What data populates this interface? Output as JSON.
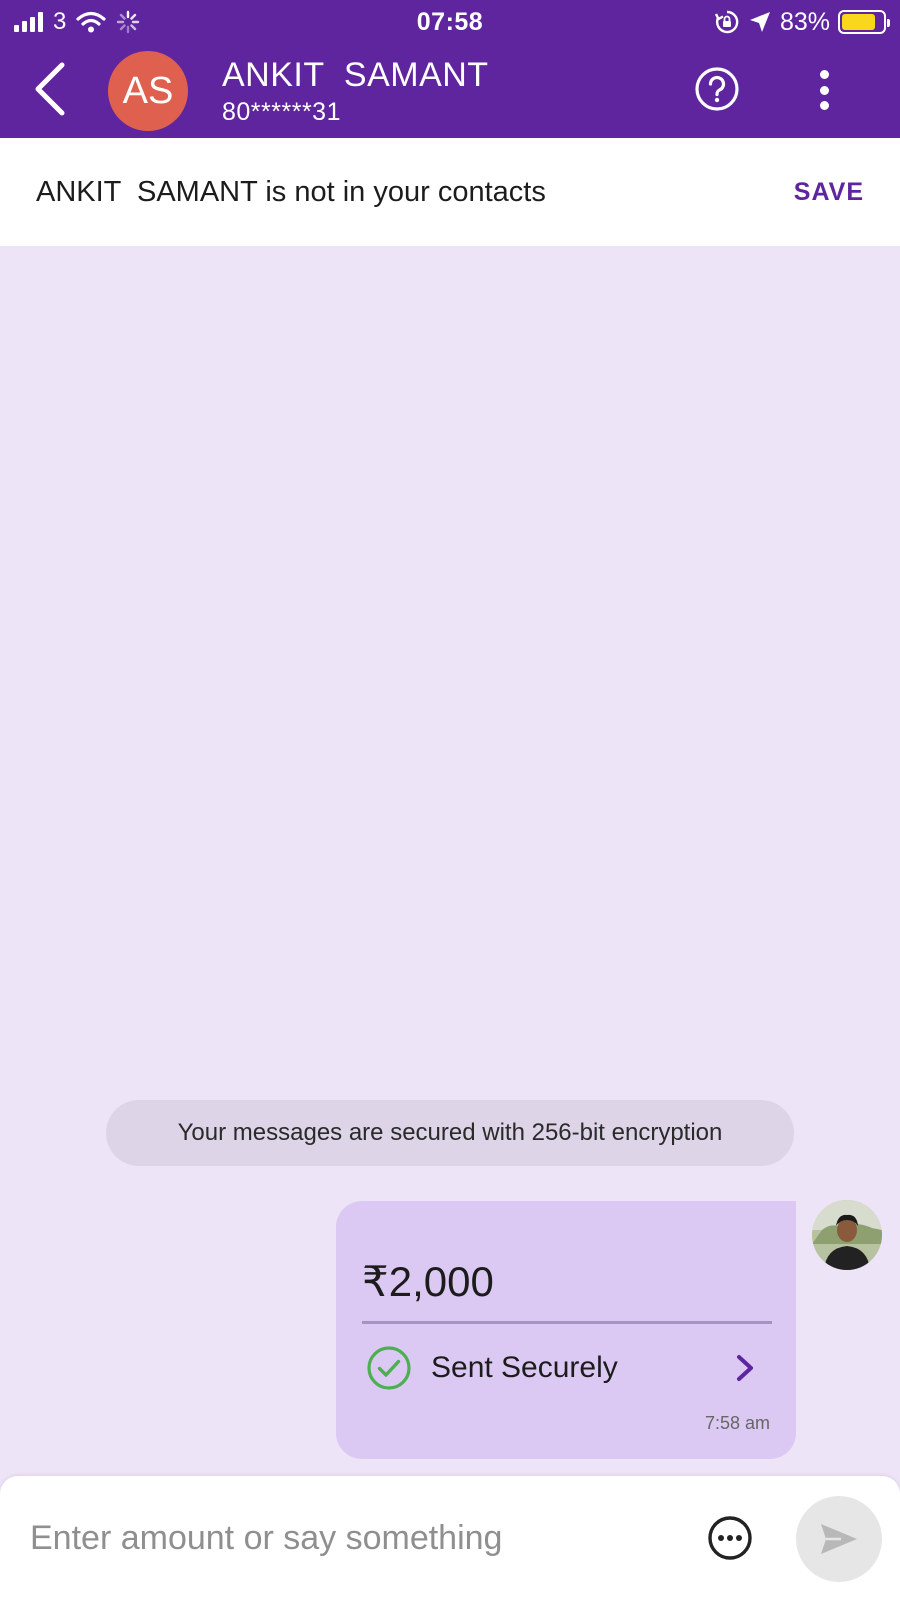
{
  "status_bar": {
    "carrier": "3",
    "time": "07:58",
    "battery_percent": "83%",
    "battery_level": 0.83,
    "battery_color": "#f9d71c"
  },
  "header": {
    "background": "#5f259f",
    "avatar_initials": "AS",
    "avatar_color": "#e0604f",
    "contact_name": "ANKIT  SAMANT",
    "contact_number": "80******31",
    "icons": [
      "back-icon",
      "help-icon",
      "more-vertical-icon"
    ]
  },
  "banner": {
    "message": "ANKIT  SAMANT is not in your contacts",
    "save_label": "SAVE"
  },
  "chat": {
    "encryption_notice": "Your messages are secured with 256-bit encryption",
    "payment": {
      "amount": "₹2,000",
      "status": "Sent Securely",
      "time": "7:58 am",
      "status_color": "#4caf50"
    }
  },
  "input": {
    "placeholder": "Enter amount or say something",
    "value": ""
  }
}
